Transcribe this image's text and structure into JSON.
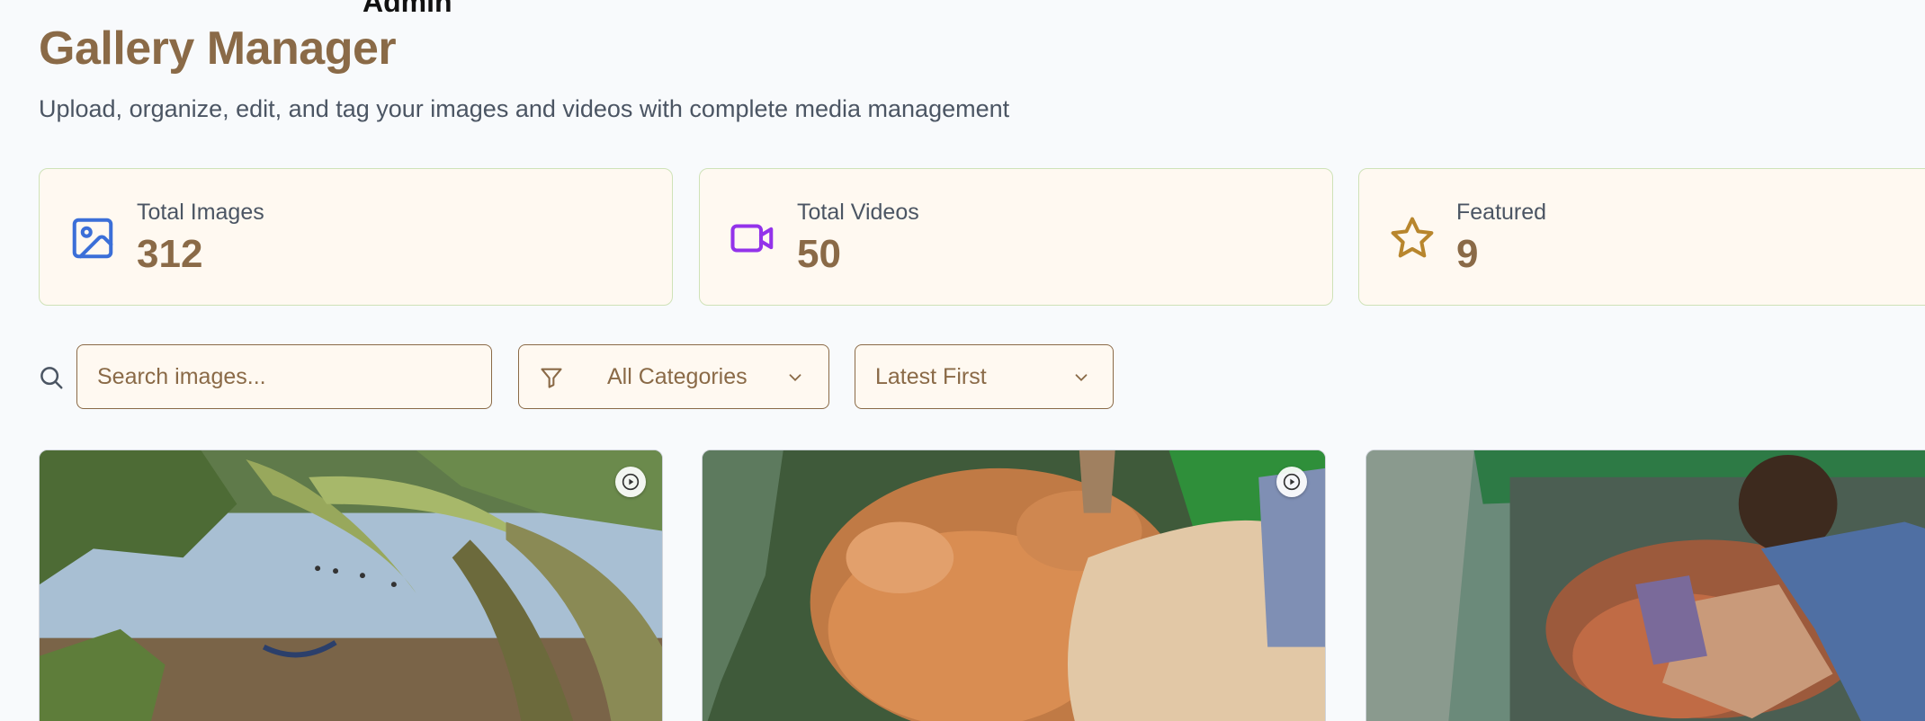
{
  "header": {
    "top_label": "Admin",
    "title": "Gallery Manager",
    "subtitle": "Upload, organize, edit, and tag your images and videos with complete media management"
  },
  "stats": [
    {
      "label": "Total Images",
      "value": "312",
      "icon": "image-icon",
      "color": "#3b6fd8"
    },
    {
      "label": "Total Videos",
      "value": "50",
      "icon": "video-icon",
      "color": "#9333ea"
    },
    {
      "label": "Featured",
      "value": "9",
      "icon": "star-icon",
      "color": "#b8862d"
    }
  ],
  "toolbar": {
    "search_placeholder": "Search images...",
    "category_select": "All Categories",
    "sort_select": "Latest First"
  },
  "gallery": [
    {
      "scene": "lake with palm trees and hammock",
      "badge_icon": "play-icon"
    },
    {
      "scene": "hand in tank of orange fish",
      "badge_icon": "play-icon"
    },
    {
      "scene": "boy sitting at fish tank"
    }
  ],
  "colors": {
    "brand": "#8a6a47",
    "card_bg": "#fff9f1",
    "card_border": "#cfe2b8",
    "page_bg": "#f8fafc"
  }
}
